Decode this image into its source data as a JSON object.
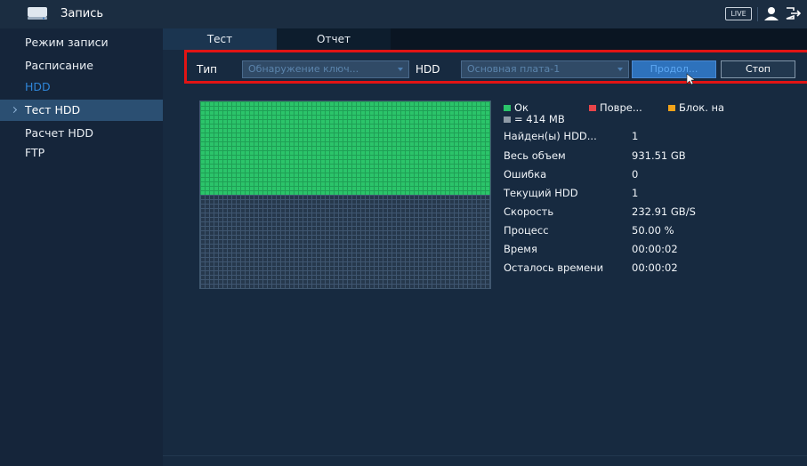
{
  "header": {
    "title": "Запись",
    "live_label": "LIVE",
    "icons": [
      "hdd-icon",
      "user-icon",
      "logout-icon"
    ]
  },
  "sidebar": {
    "items": [
      {
        "label": "Режим записи",
        "state": "normal"
      },
      {
        "label": "Расписание",
        "state": "normal"
      },
      {
        "label": "HDD",
        "state": "dim"
      },
      {
        "label": "Тест HDD",
        "state": "active"
      },
      {
        "label": "Расчет HDD",
        "state": "normal"
      },
      {
        "label": "FTP",
        "state": "normal"
      }
    ]
  },
  "tabs": [
    {
      "label": "Тест",
      "active": true
    },
    {
      "label": "Отчет",
      "active": false
    }
  ],
  "toolbar": {
    "type_label": "Тип",
    "type_value": "Обнаружение ключ...",
    "hdd_label": "HDD",
    "hdd_value": "Основная плата-1",
    "continue_label": "Продол...",
    "stop_label": "Стоп"
  },
  "legend": {
    "ok_label": "Ок",
    "damaged_label": "Повре...",
    "block_label": "Блок. на",
    "block_size_label": "= 414 MB",
    "colors": {
      "ok": "#2bc46a",
      "damaged": "#e8454a",
      "block": "#f2a31a",
      "size": "#8e9aa6"
    }
  },
  "stats": [
    {
      "label": "Найден(ы) HDD...",
      "value": "1"
    },
    {
      "label": "Весь объем",
      "value": "931.51 GB"
    },
    {
      "label": "Ошибка",
      "value": "0"
    },
    {
      "label": "Текущий HDD",
      "value": "1"
    },
    {
      "label": "Скорость",
      "value": "232.91 GB/S"
    },
    {
      "label": "Процесс",
      "value": "50.00 %"
    },
    {
      "label": "Время",
      "value": "00:00:02"
    },
    {
      "label": "Осталось времени",
      "value": "00:00:02"
    }
  ],
  "progress_fraction": 0.5,
  "colors": {
    "accent": "#2e72bc",
    "highlight": "#e21414",
    "ok": "#2bc46a"
  }
}
